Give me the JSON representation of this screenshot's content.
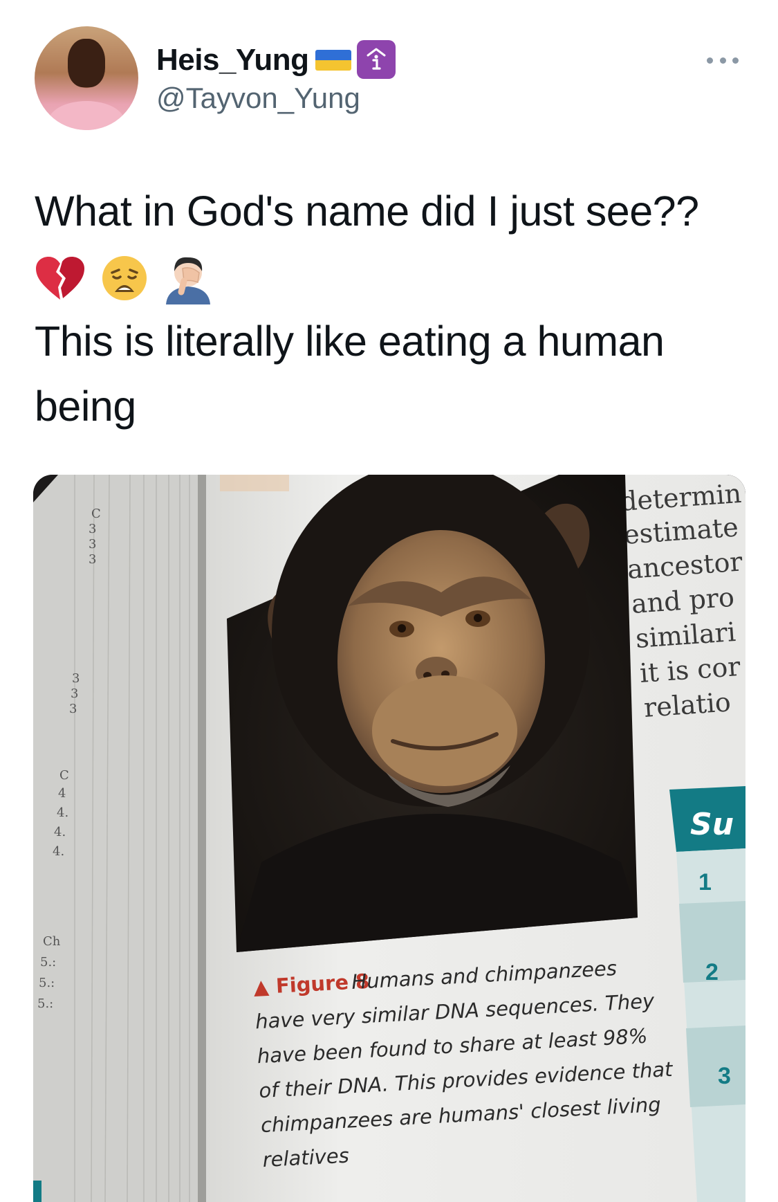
{
  "tweet": {
    "author": {
      "display_name": "Heis_Yung",
      "handle": "@Tayvon_Yung",
      "badges": [
        "ukraine-flag",
        "info-badge"
      ]
    },
    "text_line1": "What in God's name did I just see??",
    "emojis": [
      "broken-heart-icon",
      "weary-face-icon",
      "man-facepalming-icon"
    ],
    "text_line2": "This is literally like eating a human being"
  },
  "photo": {
    "subject": "chimpanzee",
    "side_text": [
      "determin",
      "estimate",
      "ancestor",
      "and pro",
      "similari",
      "it is cor",
      "relatio"
    ],
    "summary_header": "Su",
    "summary_numbers": [
      "1",
      "2",
      "3"
    ],
    "margin_labels": [
      "C",
      "3",
      "3",
      "3",
      "3",
      "3",
      "3",
      "C",
      "4",
      "4.",
      "4.",
      "4.",
      "Ch",
      "5.:",
      "5.:",
      "5.:"
    ],
    "figure_label": "▲ Figure 8",
    "caption_lines": [
      "Humans and chimpanzees",
      "have very similar DNA sequences. They",
      "have been found to share at least 98%",
      "of their DNA. This provides evidence that",
      "chimpanzees are humans' closest living",
      "relatives"
    ]
  },
  "colors": {
    "text": "#0f1419",
    "secondary": "#536471",
    "figure_red": "#c0392b",
    "summary_teal": "#137b85"
  }
}
